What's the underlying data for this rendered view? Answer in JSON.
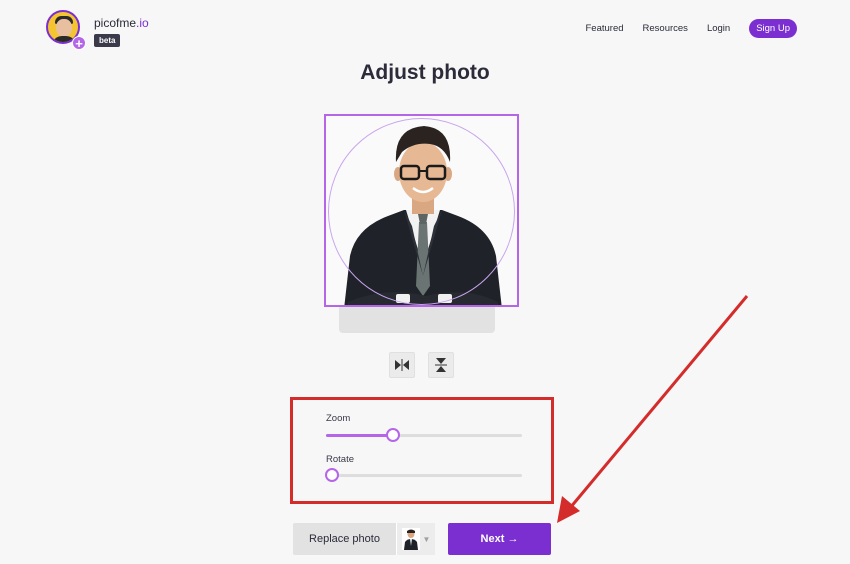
{
  "brand": {
    "name_main": "picofme",
    "name_tld": ".io",
    "badge": "beta"
  },
  "nav": {
    "items": [
      "Featured",
      "Resources",
      "Login"
    ],
    "signup": "Sign Up"
  },
  "page": {
    "title": "Adjust photo"
  },
  "sliders": {
    "zoom": {
      "label": "Zoom",
      "value_fraction": 0.34
    },
    "rotate": {
      "label": "Rotate",
      "value_fraction": 0.0
    }
  },
  "actions": {
    "replace": "Replace photo",
    "next": "Next →"
  },
  "colors": {
    "accent": "#7b2fd1",
    "accent_light": "#b566e8",
    "highlight": "#d42b2b"
  },
  "icons": {
    "flip_horizontal": "flip-horizontal-icon",
    "flip_vertical": "flip-vertical-icon"
  }
}
